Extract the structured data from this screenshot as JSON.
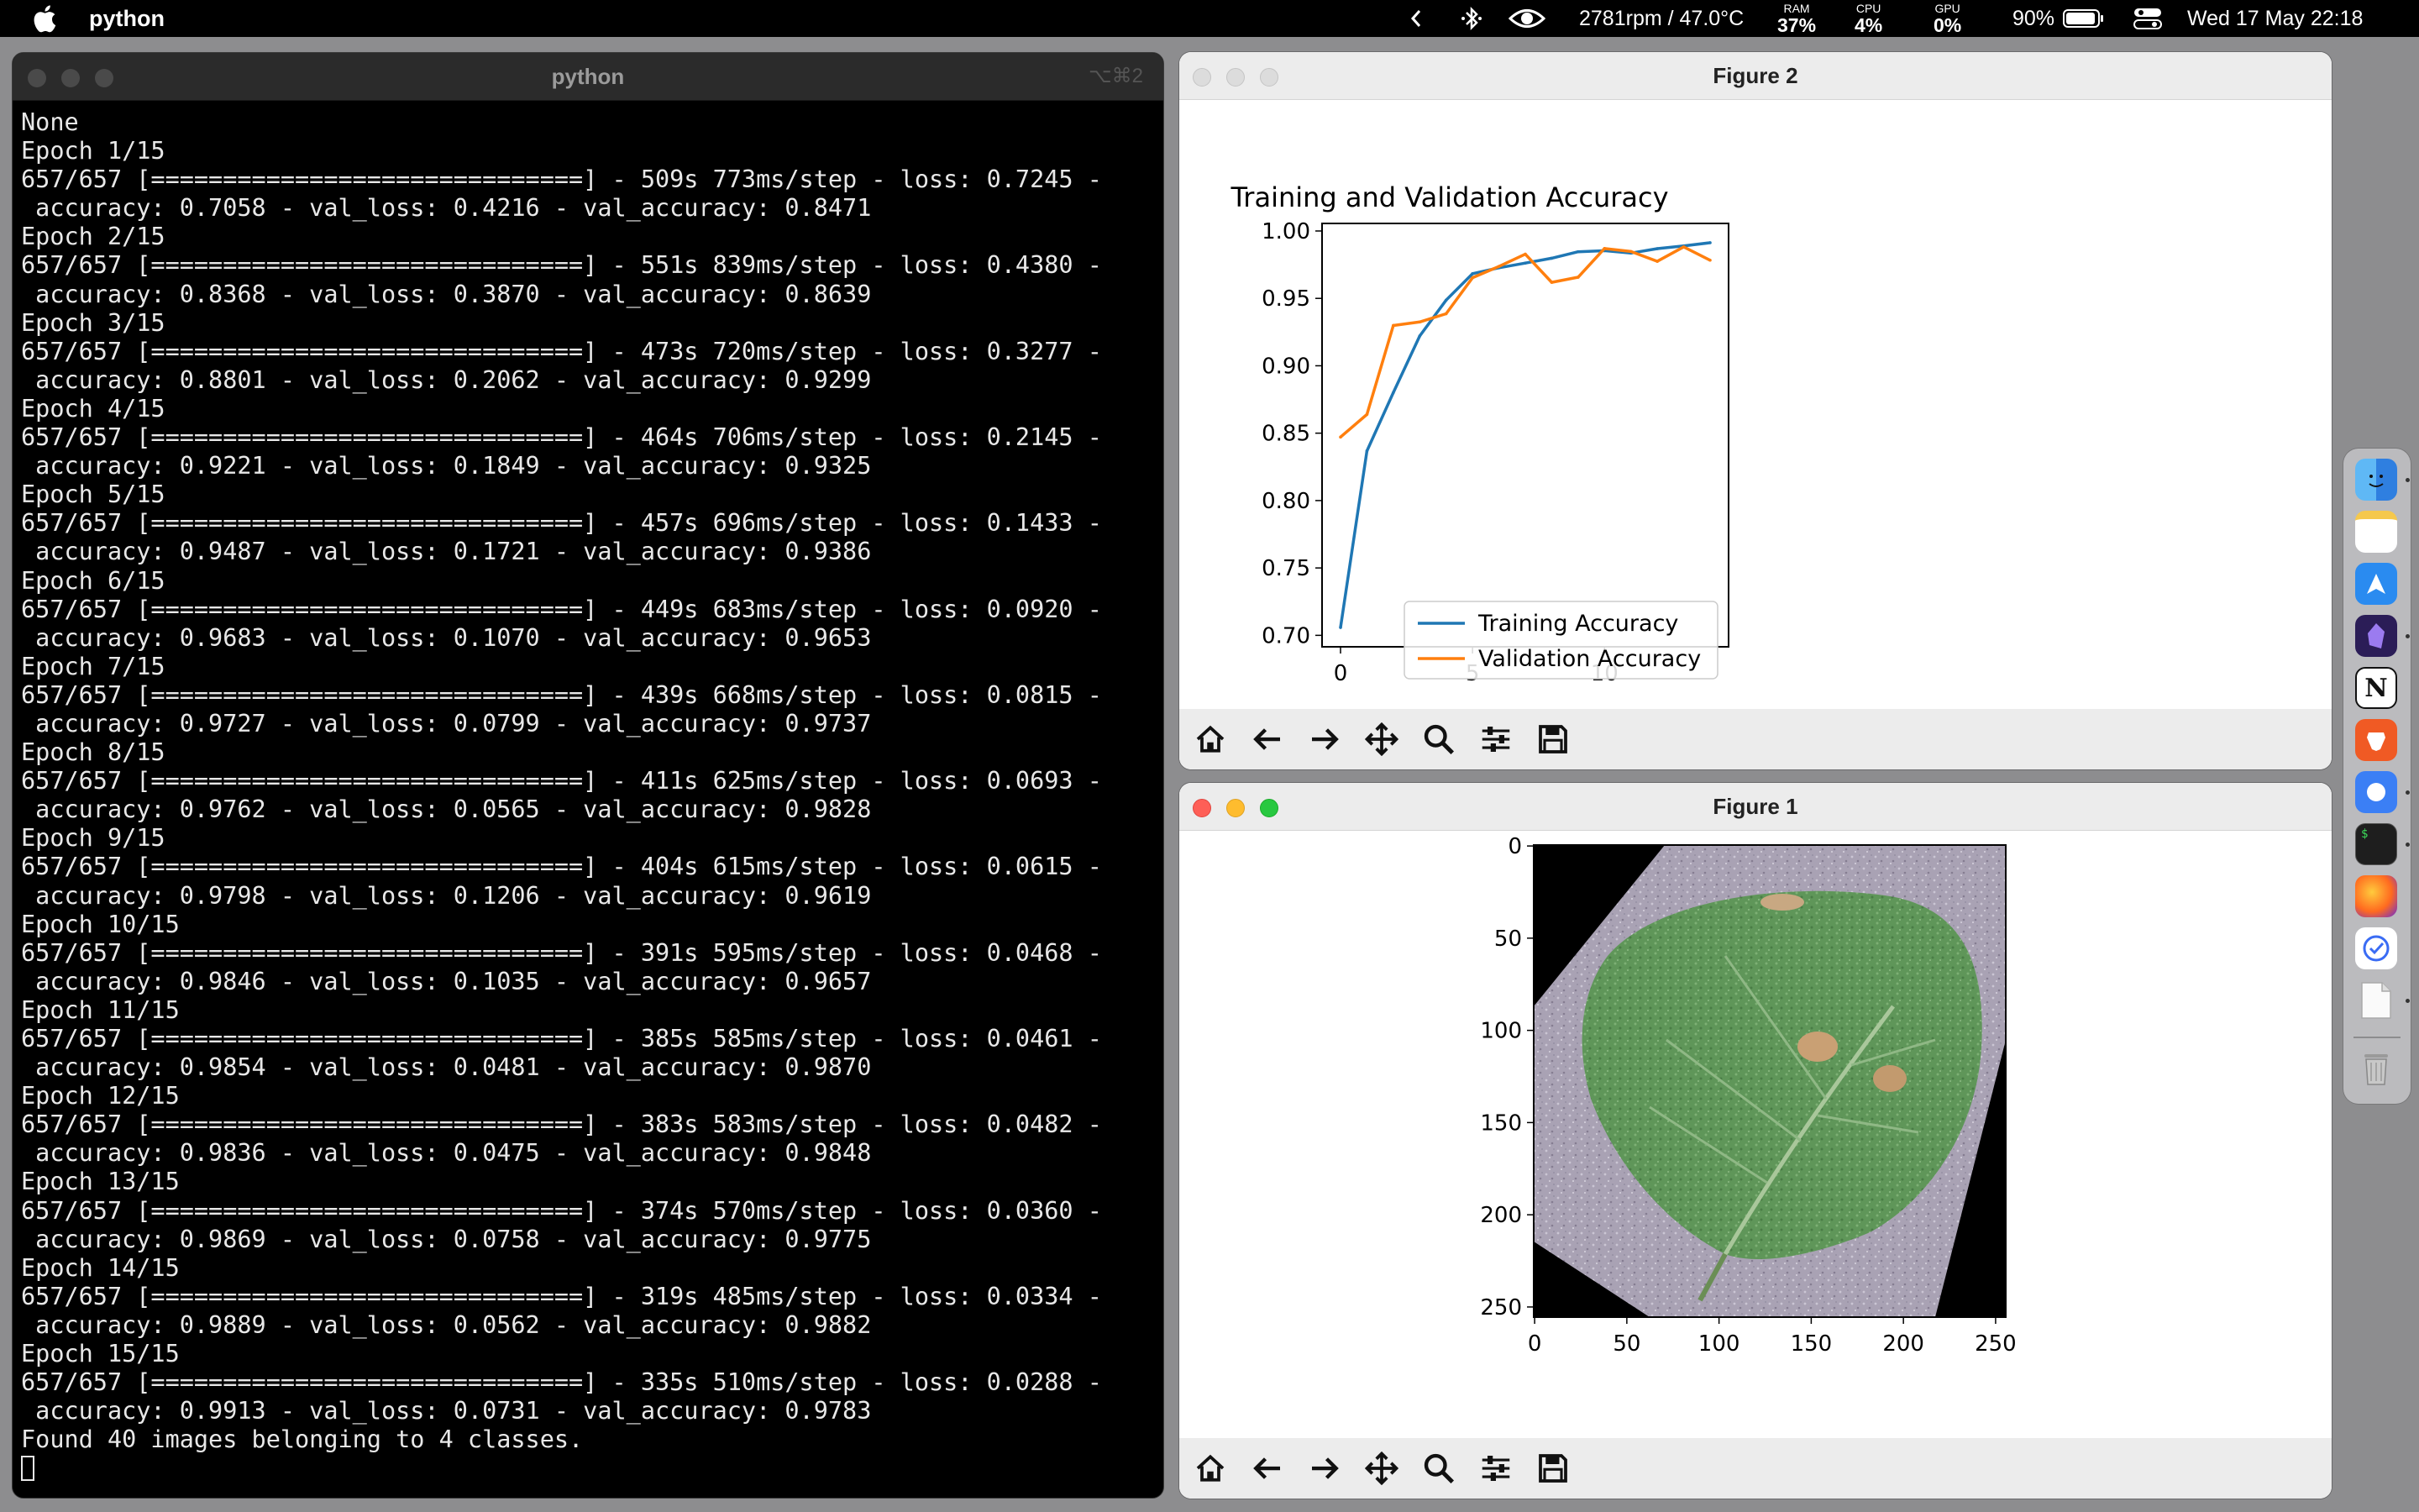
{
  "menubar": {
    "app_name": "python",
    "fan_temp": "2781rpm / 47.0°C",
    "ram": {
      "label": "RAM",
      "value": "37%"
    },
    "cpu": {
      "label": "CPU",
      "value": "4%"
    },
    "gpu": {
      "label": "GPU",
      "value": "0%"
    },
    "battery": "90%",
    "clock": "Wed 17 May  22:18",
    "icons": [
      "apple-icon",
      "chevron-left-icon",
      "bluetooth-icon",
      "eye-icon",
      "battery-icon",
      "control-center-icon"
    ]
  },
  "terminal": {
    "title": "python",
    "shortcut": "⌥⌘2",
    "lines": [
      "None",
      "Epoch 1/15",
      "657/657 [==============================] - 509s 773ms/step - loss: 0.7245 -",
      " accuracy: 0.7058 - val_loss: 0.4216 - val_accuracy: 0.8471",
      "Epoch 2/15",
      "657/657 [==============================] - 551s 839ms/step - loss: 0.4380 -",
      " accuracy: 0.8368 - val_loss: 0.3870 - val_accuracy: 0.8639",
      "Epoch 3/15",
      "657/657 [==============================] - 473s 720ms/step - loss: 0.3277 -",
      " accuracy: 0.8801 - val_loss: 0.2062 - val_accuracy: 0.9299",
      "Epoch 4/15",
      "657/657 [==============================] - 464s 706ms/step - loss: 0.2145 -",
      " accuracy: 0.9221 - val_loss: 0.1849 - val_accuracy: 0.9325",
      "Epoch 5/15",
      "657/657 [==============================] - 457s 696ms/step - loss: 0.1433 -",
      " accuracy: 0.9487 - val_loss: 0.1721 - val_accuracy: 0.9386",
      "Epoch 6/15",
      "657/657 [==============================] - 449s 683ms/step - loss: 0.0920 -",
      " accuracy: 0.9683 - val_loss: 0.1070 - val_accuracy: 0.9653",
      "Epoch 7/15",
      "657/657 [==============================] - 439s 668ms/step - loss: 0.0815 -",
      " accuracy: 0.9727 - val_loss: 0.0799 - val_accuracy: 0.9737",
      "Epoch 8/15",
      "657/657 [==============================] - 411s 625ms/step - loss: 0.0693 -",
      " accuracy: 0.9762 - val_loss: 0.0565 - val_accuracy: 0.9828",
      "Epoch 9/15",
      "657/657 [==============================] - 404s 615ms/step - loss: 0.0615 -",
      " accuracy: 0.9798 - val_loss: 0.1206 - val_accuracy: 0.9619",
      "Epoch 10/15",
      "657/657 [==============================] - 391s 595ms/step - loss: 0.0468 -",
      " accuracy: 0.9846 - val_loss: 0.1035 - val_accuracy: 0.9657",
      "Epoch 11/15",
      "657/657 [==============================] - 385s 585ms/step - loss: 0.0461 -",
      " accuracy: 0.9854 - val_loss: 0.0481 - val_accuracy: 0.9870",
      "Epoch 12/15",
      "657/657 [==============================] - 383s 583ms/step - loss: 0.0482 -",
      " accuracy: 0.9836 - val_loss: 0.0475 - val_accuracy: 0.9848",
      "Epoch 13/15",
      "657/657 [==============================] - 374s 570ms/step - loss: 0.0360 -",
      " accuracy: 0.9869 - val_loss: 0.0758 - val_accuracy: 0.9775",
      "Epoch 14/15",
      "657/657 [==============================] - 319s 485ms/step - loss: 0.0334 -",
      " accuracy: 0.9889 - val_loss: 0.0562 - val_accuracy: 0.9882",
      "Epoch 15/15",
      "657/657 [==============================] - 335s 510ms/step - loss: 0.0288 -",
      " accuracy: 0.9913 - val_loss: 0.0731 - val_accuracy: 0.9783",
      "Found 40 images belonging to 4 classes."
    ]
  },
  "figure2": {
    "title": "Figure 2",
    "toolbar": [
      "home-icon",
      "back-arrow-icon",
      "forward-arrow-icon",
      "pan-icon",
      "zoom-icon",
      "configure-subplots-icon",
      "save-icon"
    ]
  },
  "figure1": {
    "title": "Figure 1",
    "image_subject": "leaf-image",
    "toolbar": [
      "home-icon",
      "back-arrow-icon",
      "forward-arrow-icon",
      "pan-icon",
      "zoom-icon",
      "configure-subplots-icon",
      "save-icon"
    ],
    "axes": {
      "xticks": [
        0,
        50,
        100,
        150,
        200,
        250
      ],
      "yticks": [
        0,
        50,
        100,
        150,
        200,
        250
      ],
      "xlim": [
        -0.5,
        255.5
      ],
      "ylim": [
        255.5,
        -0.5
      ]
    }
  },
  "chart_data": {
    "type": "line",
    "title": "Training and Validation Accuracy",
    "xlabel": "",
    "ylabel": "",
    "x": [
      0,
      1,
      2,
      3,
      4,
      5,
      6,
      7,
      8,
      9,
      10,
      11,
      12,
      13,
      14
    ],
    "series": [
      {
        "name": "Training Accuracy",
        "color": "#1f77b4",
        "values": [
          0.7058,
          0.8368,
          0.8801,
          0.9221,
          0.9487,
          0.9683,
          0.9727,
          0.9762,
          0.9798,
          0.9846,
          0.9854,
          0.9836,
          0.9869,
          0.9889,
          0.9913
        ]
      },
      {
        "name": "Validation Accuracy",
        "color": "#ff7f0e",
        "values": [
          0.8471,
          0.8639,
          0.9299,
          0.9325,
          0.9386,
          0.9653,
          0.9737,
          0.9828,
          0.9619,
          0.9657,
          0.987,
          0.9848,
          0.9775,
          0.9882,
          0.9783
        ]
      }
    ],
    "xticks": [
      0,
      5,
      10
    ],
    "yticks": [
      0.7,
      0.75,
      0.8,
      0.85,
      0.9,
      0.95,
      1.0
    ],
    "xlim": [
      -0.7,
      14.7
    ],
    "ylim": [
      0.6915,
      1.0056
    ],
    "legend": "lower-right",
    "grid": false
  }
}
